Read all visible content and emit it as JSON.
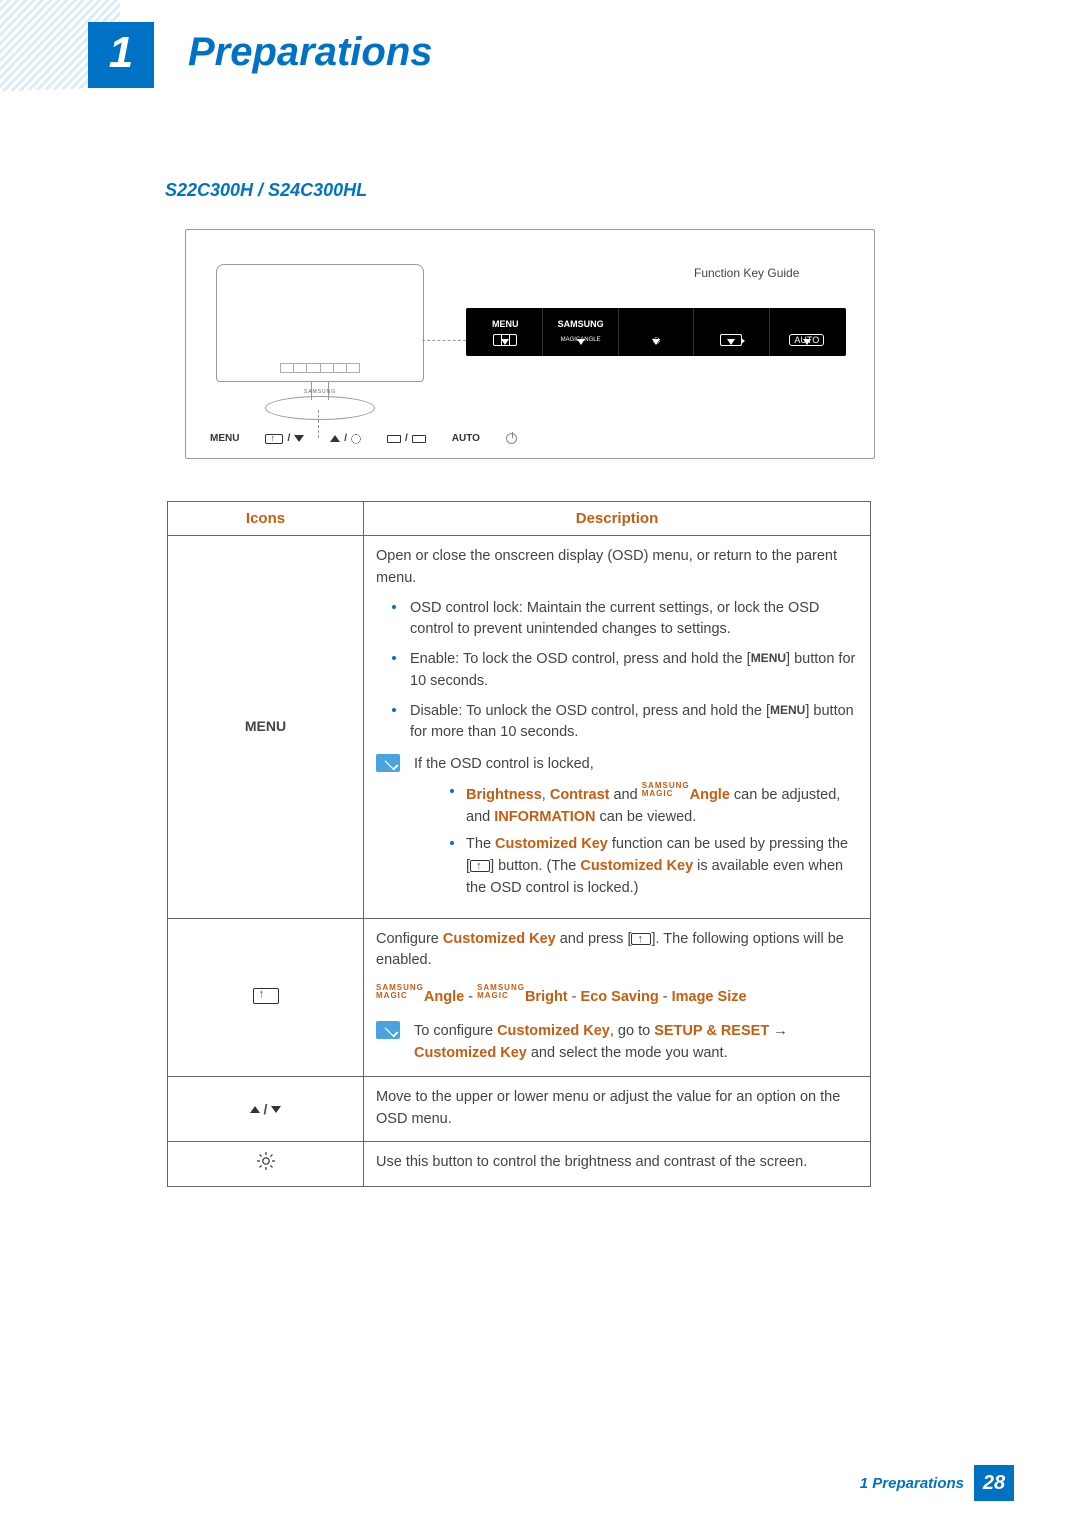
{
  "header": {
    "chapter_number": "1",
    "chapter_title": "Preparations"
  },
  "content": {
    "model_heading": "S22C300H / S24C300HL",
    "fk_guide_label": "Function Key Guide",
    "fk_bar": {
      "c1_top": "MENU",
      "c2_top": "SAMSUNG",
      "c2_mid1": "MAGIC",
      "c2_mid2": "ANGLE",
      "c5_pill": "AUTO"
    },
    "btn_row": {
      "b1": "MENU",
      "b5": "AUTO"
    },
    "table": {
      "h_icons": "Icons",
      "h_desc": "Description",
      "r1": {
        "icon_label": "MENU",
        "intro": "Open or close the onscreen display (OSD) menu, or return to the parent menu.",
        "li1": "OSD control lock: Maintain the current settings, or lock the OSD control to prevent unintended changes to settings.",
        "li2a": "Enable: To lock the OSD control, press and hold the [",
        "li2_tag": "MENU",
        "li2b": "] button for 10 seconds.",
        "li3a": "Disable: To unlock the OSD control, press and hold the [",
        "li3_tag": "MENU",
        "li3b": "] button for more than 10 seconds.",
        "note_lead": "If the OSD control is locked,",
        "sub1_b1": "Brightness",
        "sub1_c1": ", ",
        "sub1_b2": "Contrast",
        "sub1_c2": " and ",
        "sub1_b3": "Angle",
        "sub1_c3": " can be adjusted, and ",
        "sub1_b4": "INFORMATION",
        "sub1_c4": " can be viewed.",
        "sub2_a": "The ",
        "sub2_b1": "Customized Key",
        "sub2_b": " function can be used by pressing the [",
        "sub2_c": "] button. (The ",
        "sub2_b2": "Customized Key",
        "sub2_d": " is available even when the OSD control is locked.)"
      },
      "r2": {
        "p1a": "Configure ",
        "p1b": "Customized Key",
        "p1c": " and press [",
        "p1d": "]. The following options will be enabled.",
        "opts_a": "Angle",
        "opts_sep": " - ",
        "opts_b": "Bright",
        "opts_c": "Eco Saving",
        "opts_d": "Image Size",
        "note_a": "To configure ",
        "note_b1": "Customized Key",
        "note_b": ", go to ",
        "note_b2": "SETUP & RESET",
        "note_arrow": "  →  ",
        "note_b3": "Customized Key",
        "note_c": " and select the mode you want."
      },
      "r3": "Move to the upper or lower menu or adjust the value for an option on the OSD menu.",
      "r4": "Use this button to control the brightness and contrast of the screen."
    }
  },
  "footer": {
    "label": "1  Preparations",
    "page": "28"
  }
}
